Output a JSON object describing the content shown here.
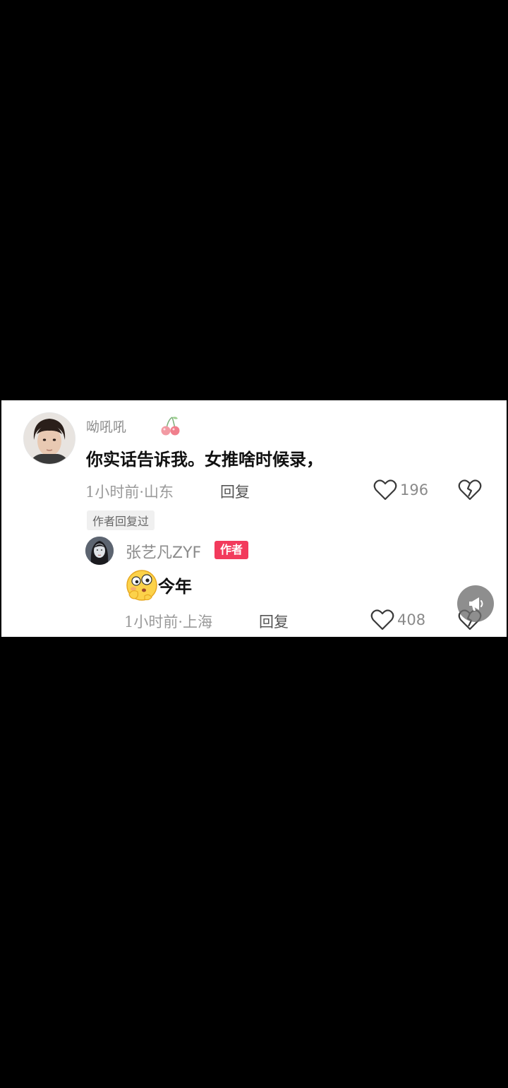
{
  "comment": {
    "username": "呦吼吼",
    "text": "你实话告诉我。女推啥时候录，",
    "meta": "1小时前·山东",
    "reply_label": "回复",
    "likes": "196",
    "author_replied_tag": "作者回复过",
    "username_badge_icon": "cherry-icon"
  },
  "reply": {
    "username": "张艺凡ZYF",
    "author_badge": "作者",
    "emoji_icon": "thinking-face-emoji",
    "text": "今年",
    "meta": "1小时前·上海",
    "reply_label": "回复",
    "likes": "408"
  },
  "colors": {
    "background": "#000000",
    "card": "#ffffff",
    "author_badge": "#f23a5c",
    "meta_text": "#9a9a9a"
  }
}
